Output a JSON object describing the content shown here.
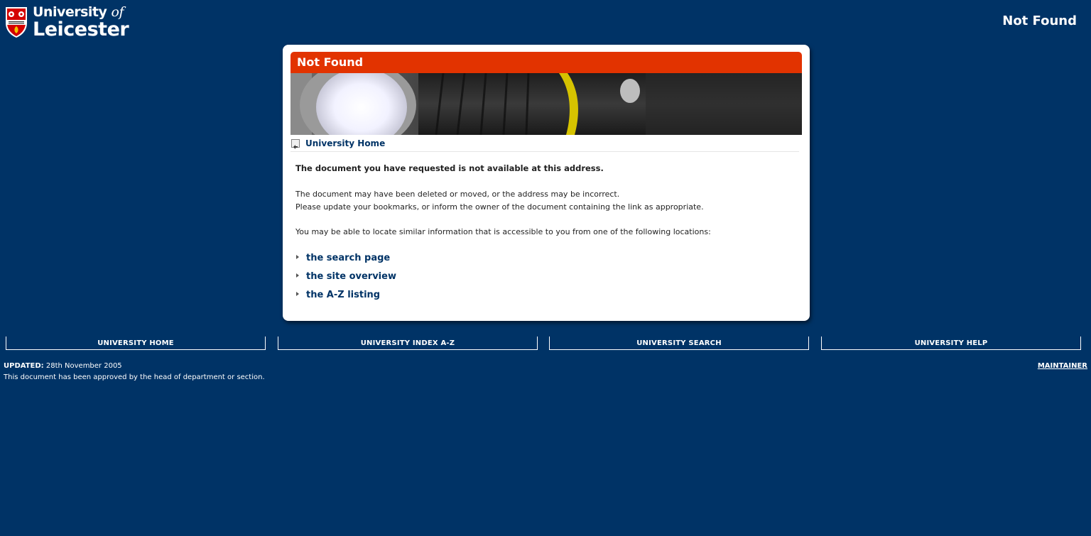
{
  "header": {
    "logo_line1_main": "University ",
    "logo_line1_of": "of",
    "logo_line2": "Leicester",
    "page_title": "Not Found"
  },
  "panel": {
    "title": "Not Found",
    "home_link": "University Home",
    "message_bold": "The document you have requested is not available at this address.",
    "message_p1": "The document may have been deleted or moved, or the address may be incorrect.",
    "message_p2": "Please update your bookmarks, or inform the owner of the document containing the link as appropriate.",
    "message_p3": "You may be able to locate similar information that is accessible to you from one of the following locations:",
    "locations": [
      {
        "label": "the search page"
      },
      {
        "label": "the site overview"
      },
      {
        "label": "the A-Z listing"
      }
    ]
  },
  "footer": {
    "nav": [
      {
        "label": "UNIVERSITY HOME"
      },
      {
        "label": "UNIVERSITY INDEX A-Z"
      },
      {
        "label": "UNIVERSITY SEARCH"
      },
      {
        "label": "UNIVERSITY HELP"
      }
    ],
    "updated_label": "UPDATED:",
    "updated_date": "28th November 2005",
    "approval_note": "This document has been approved by the head of department or section.",
    "maintainer": "MAINTAINER"
  },
  "colors": {
    "background": "#003366",
    "title_bar": "#e23300",
    "link": "#003366"
  },
  "icons": [
    "university-crest-icon",
    "back-arrow-icon",
    "bullet-arrow-icon"
  ]
}
